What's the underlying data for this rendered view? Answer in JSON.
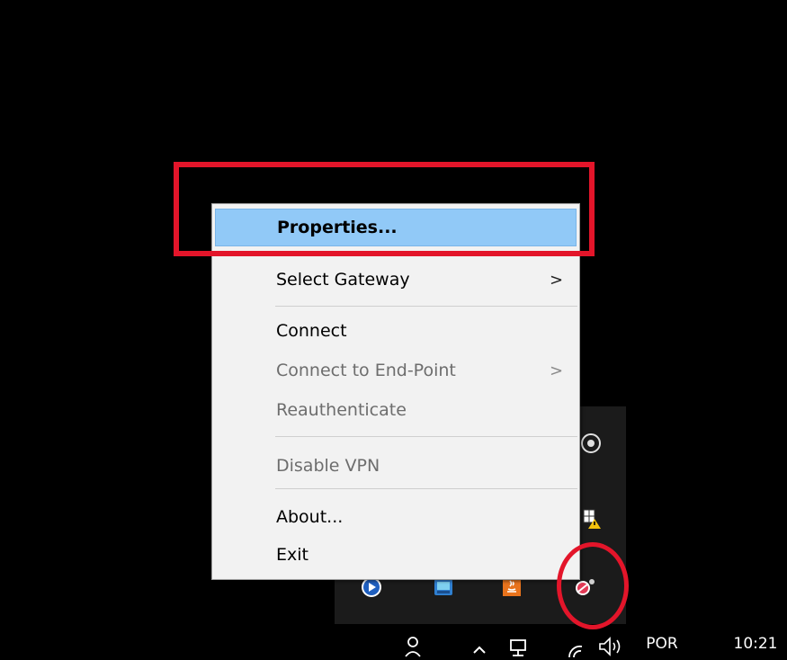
{
  "menu": {
    "items": [
      {
        "label": "Properties...",
        "state": "highlighted",
        "submenu": false
      },
      {
        "label": "Select Gateway",
        "state": "enabled",
        "submenu": true,
        "arrow": ">"
      },
      {
        "label": "Connect",
        "state": "enabled",
        "submenu": false
      },
      {
        "label": "Connect to End-Point",
        "state": "disabled",
        "submenu": true,
        "arrow": ">"
      },
      {
        "label": "Reauthenticate",
        "state": "disabled",
        "submenu": false
      },
      {
        "label": "Disable VPN",
        "state": "disabled",
        "submenu": false
      },
      {
        "label": "About...",
        "state": "enabled",
        "submenu": false
      },
      {
        "label": "Exit",
        "state": "enabled",
        "submenu": false
      }
    ]
  },
  "tray_icons": [
    "media-player-icon",
    "network-app-icon",
    "java-icon",
    "vpn-client-icon",
    "webcam-icon",
    "security-shield-icon"
  ],
  "taskbar": {
    "language": "POR",
    "time": "10:21",
    "icons": [
      "people-icon",
      "show-hidden-icons-chevron",
      "network-icon",
      "wifi-icon",
      "volume-icon"
    ]
  },
  "colors": {
    "annotation": "#e3152a",
    "menu_highlight": "#91c9f7",
    "menu_background": "#f2f2f2",
    "tray_background": "#1b1b1b"
  }
}
